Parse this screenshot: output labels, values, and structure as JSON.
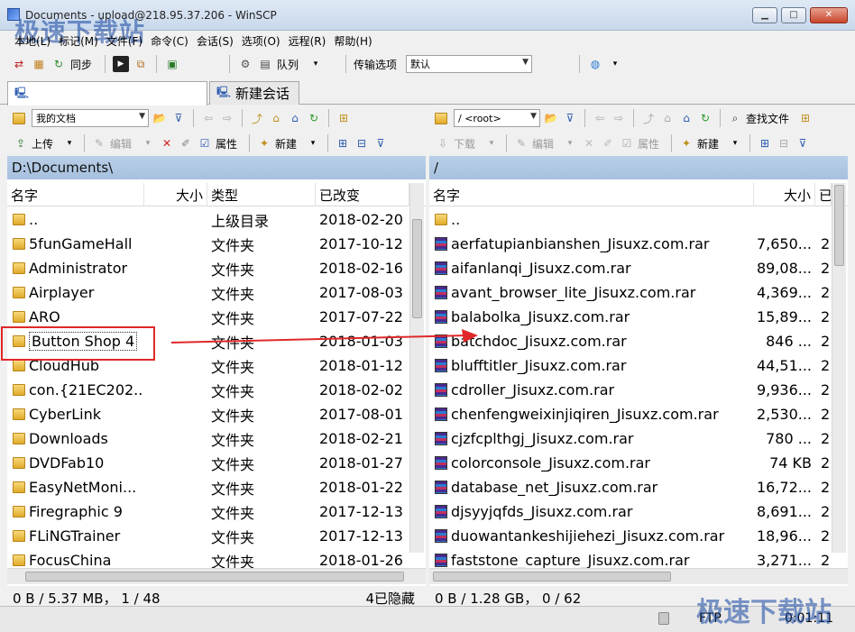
{
  "window": {
    "title": "Documents - upload@218.95.37.206 - WinSCP",
    "watermark": "极速下载站"
  },
  "menu": [
    "本地(L)",
    "标记(M)",
    "文件(F)",
    "命令(C)",
    "会话(S)",
    "选项(O)",
    "远程(R)",
    "帮助(H)"
  ],
  "toolbar": {
    "sync_label": "同步",
    "queue_label": "队列",
    "transfer_options_label": "传输选项",
    "transfer_default": "默认"
  },
  "tabs": [
    {
      "label": ""
    },
    {
      "label": "新建会话"
    }
  ],
  "left": {
    "location": "我的文档",
    "upload_label": "上传",
    "edit_label": "编辑",
    "props_label": "属性",
    "new_label": "新建",
    "path": "D:\\Documents\\",
    "columns": [
      "名字",
      "大小",
      "类型",
      "已改变"
    ],
    "rows": [
      {
        "name": "..",
        "size": "",
        "type": "上级目录",
        "changed": "2018-02-20"
      },
      {
        "name": "5funGameHall",
        "size": "",
        "type": "文件夹",
        "changed": "2017-10-12"
      },
      {
        "name": "Administrator",
        "size": "",
        "type": "文件夹",
        "changed": "2018-02-16"
      },
      {
        "name": "Airplayer",
        "size": "",
        "type": "文件夹",
        "changed": "2017-08-03"
      },
      {
        "name": "ARO",
        "size": "",
        "type": "文件夹",
        "changed": "2017-07-22"
      },
      {
        "name": "Button Shop 4",
        "size": "",
        "type": "文件夹",
        "changed": "2018-01-03"
      },
      {
        "name": "CloudHub",
        "size": "",
        "type": "文件夹",
        "changed": "2018-01-12"
      },
      {
        "name": "con.{21EC202...",
        "size": "",
        "type": "文件夹",
        "changed": "2018-02-02"
      },
      {
        "name": "CyberLink",
        "size": "",
        "type": "文件夹",
        "changed": "2017-08-01"
      },
      {
        "name": "Downloads",
        "size": "",
        "type": "文件夹",
        "changed": "2018-02-21"
      },
      {
        "name": "DVDFab10",
        "size": "",
        "type": "文件夹",
        "changed": "2018-01-27"
      },
      {
        "name": "EasyNetMoni...",
        "size": "",
        "type": "文件夹",
        "changed": "2018-01-22"
      },
      {
        "name": "Firegraphic 9",
        "size": "",
        "type": "文件夹",
        "changed": "2017-12-13"
      },
      {
        "name": "FLiNGTrainer",
        "size": "",
        "type": "文件夹",
        "changed": "2017-12-13"
      },
      {
        "name": "FocusChina",
        "size": "",
        "type": "文件夹",
        "changed": "2018-01-26"
      }
    ],
    "status_left": "0 B / 5.37 MB， 1 / 48",
    "status_right": "4已隐藏"
  },
  "right": {
    "location": "/ <root>",
    "download_label": "下载",
    "edit_label": "编辑",
    "props_label": "属性",
    "new_label": "新建",
    "find_label": "查找文件",
    "path": "/",
    "columns": [
      "名字",
      "大小",
      "已"
    ],
    "rows": [
      {
        "name": "..",
        "size": "",
        "extra": ""
      },
      {
        "name": "aerfatupianbianshen_Jisuxz.com.rar",
        "size": "7,650...",
        "extra": "2"
      },
      {
        "name": "aifanlanqi_Jisuxz.com.rar",
        "size": "89,08...",
        "extra": "2"
      },
      {
        "name": "avant_browser_lite_Jisuxz.com.rar",
        "size": "4,369...",
        "extra": "2"
      },
      {
        "name": "balabolka_Jisuxz.com.rar",
        "size": "15,89...",
        "extra": "2"
      },
      {
        "name": "batchdoc_Jisuxz.com.rar",
        "size": "846 ...",
        "extra": "2"
      },
      {
        "name": "blufftitler_Jisuxz.com.rar",
        "size": "44,51...",
        "extra": "2"
      },
      {
        "name": "cdroller_Jisuxz.com.rar",
        "size": "9,936...",
        "extra": "2"
      },
      {
        "name": "chenfengweixinjiqiren_Jisuxz.com.rar",
        "size": "2,530...",
        "extra": "2"
      },
      {
        "name": "cjzfcplthgj_Jisuxz.com.rar",
        "size": "780 ...",
        "extra": "2"
      },
      {
        "name": "colorconsole_Jisuxz.com.rar",
        "size": "74 KB",
        "extra": "2"
      },
      {
        "name": "database_net_Jisuxz.com.rar",
        "size": "16,72...",
        "extra": "2"
      },
      {
        "name": "djsyyjqfds_Jisuxz.com.rar",
        "size": "8,691...",
        "extra": "2"
      },
      {
        "name": "duowantankeshijiehezi_Jisuxz.com.rar",
        "size": "18,96...",
        "extra": "2"
      },
      {
        "name": "faststone_capture_Jisuxz.com.rar",
        "size": "3,271...",
        "extra": "2"
      }
    ],
    "status": "0 B / 1.28 GB， 0 / 62"
  },
  "bottom": {
    "protocol": "FTP",
    "time": "0:01:11"
  },
  "colors": {
    "path_bar": "#b9cfe8",
    "highlight": "#e0282a",
    "watermark": "#1446a0"
  }
}
